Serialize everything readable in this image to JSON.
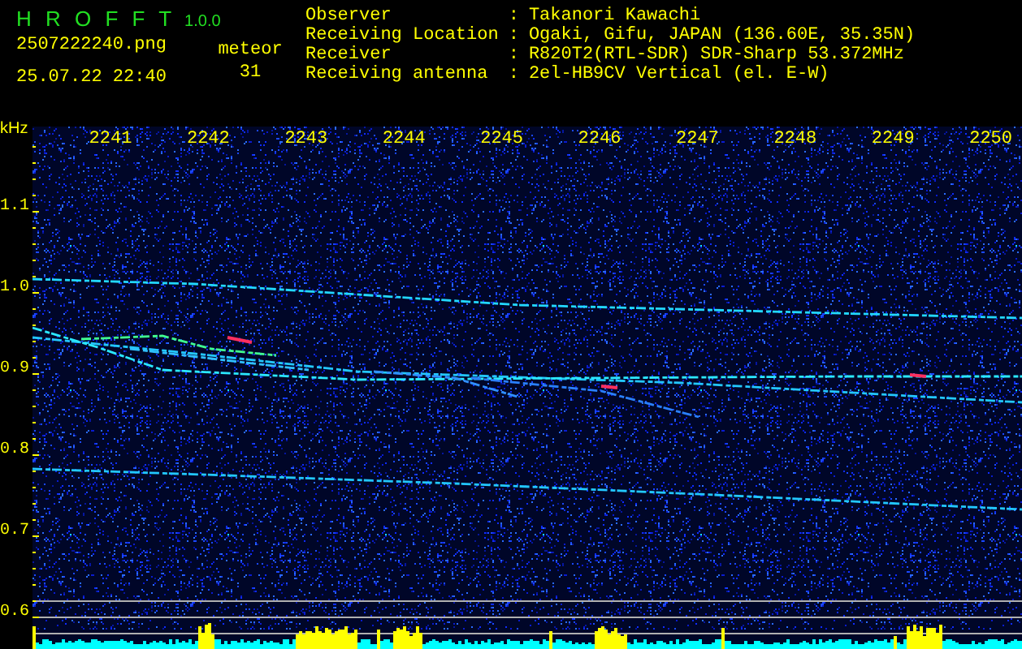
{
  "app": {
    "name": "H R O F F T",
    "version": "1.0.0"
  },
  "file": {
    "name": "2507222240.png",
    "datetime": "25.07.22 22:40"
  },
  "count": {
    "label": "meteor",
    "value": "31"
  },
  "info": [
    {
      "label": "Observer",
      "separator": ":",
      "value": "Takanori Kawachi"
    },
    {
      "label": "Receiving Location",
      "separator": ":",
      "value": "Ogaki, Gifu, JAPAN (136.60E, 35.35N)"
    },
    {
      "label": "Receiver",
      "separator": ":",
      "value": "R820T2(RTL-SDR) SDR-Sharp 53.372MHz"
    },
    {
      "label": "Receiving antenna",
      "separator": ":",
      "value": "2el-HB9CV Vertical (el. E-W)"
    }
  ],
  "spectrogram": {
    "unit": "kHz",
    "x_labels": [
      "2241",
      "2242",
      "2243",
      "2244",
      "2245",
      "2246",
      "2247",
      "2248",
      "2249",
      "2250"
    ],
    "y_labels": [
      "1.1",
      "1.0",
      "0.9",
      "0.8",
      "0.7",
      "0.6"
    ]
  }
}
